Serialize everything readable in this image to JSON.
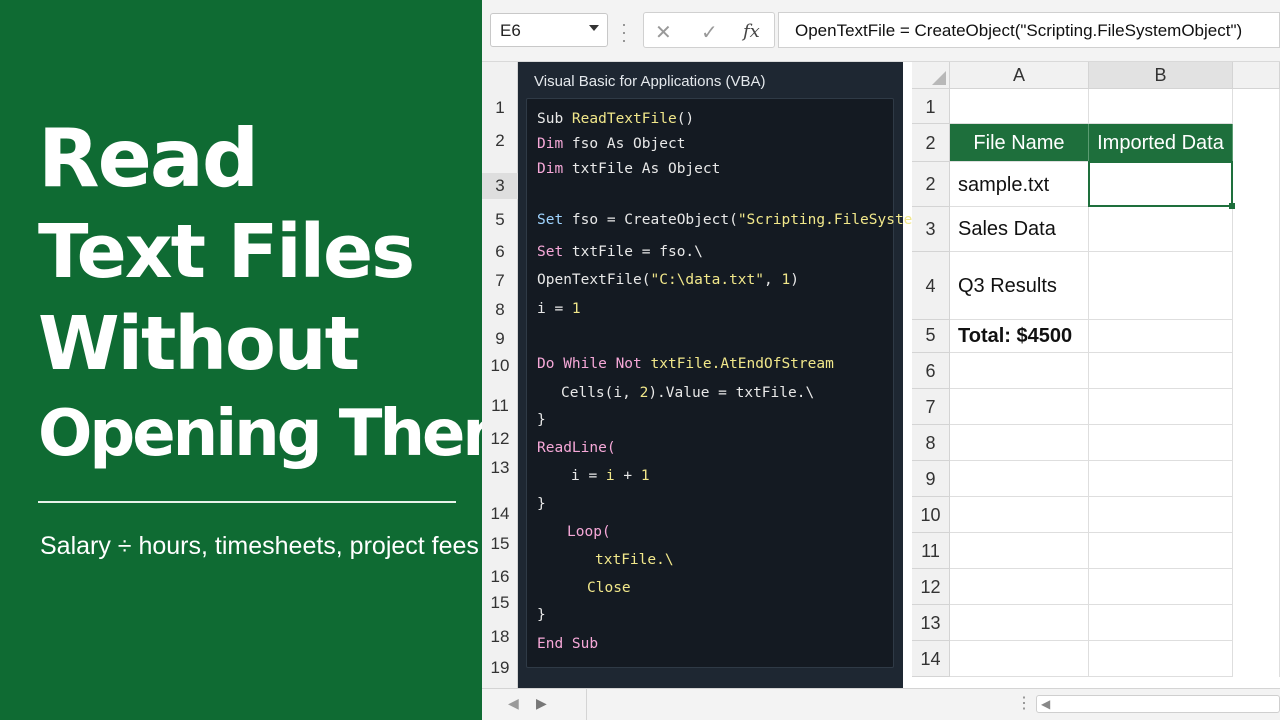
{
  "banner": {
    "title_lines": [
      "Read",
      "Text Files",
      "Without",
      "Opening Them"
    ],
    "subtitle": "Salary ÷ hours, timesheets, project fees"
  },
  "formula_bar": {
    "name_box": "E6",
    "cancel_icon": "✕",
    "enter_icon": "✓",
    "fx_label": "fx",
    "formula": "OpenTextFile = CreateObject(\"Scripting.FileSystemObject\")"
  },
  "left_row_numbers": [
    "1",
    "2",
    "3",
    "5",
    "6",
    "7",
    "8",
    "9",
    "10",
    "11",
    "12",
    "13",
    "14",
    "15",
    "16",
    "15",
    "18",
    "19"
  ],
  "vba": {
    "header": "Visual Basic for Applications (VBA)",
    "code_lines": [
      "Sub ReadTextFile()",
      "Dim fso As Object",
      "Dim txtFile As Object",
      "Set fso = CreateObject(\"Scripting.FileSystemObject\")",
      "Set txtFile = fso.\\",
      "OpenTextFile(\"C:\\data.txt\", 1)",
      "i = 1",
      "Do While Not txtFile.AtEndOfStream",
      "Cells(i, 2).Value = txtFile.\\",
      "}",
      "ReadLine(",
      "i = i + 1",
      "}",
      "Loop(",
      "txtFile.\\",
      "Close",
      "}",
      "End Sub"
    ]
  },
  "sheet": {
    "columns": [
      "A",
      "B"
    ],
    "row_headers": [
      "1",
      "2",
      "2",
      "3",
      "4",
      "5",
      "6",
      "7",
      "8",
      "9",
      "10",
      "11",
      "12",
      "13",
      "14"
    ],
    "header_row": {
      "a": "File Name",
      "b": "Imported Data"
    },
    "rows": [
      {
        "a": "sample.txt",
        "b": ""
      },
      {
        "a": "Sales Data",
        "b": ""
      },
      {
        "a": "Q3 Results",
        "b": ""
      },
      {
        "a": "Total: $4500",
        "b": ""
      }
    ],
    "accent_color": "#1e6f3c"
  },
  "colors": {
    "banner_bg": "#0f6b33",
    "vba_bg": "#1e2732",
    "editor_bg": "#141a22"
  }
}
